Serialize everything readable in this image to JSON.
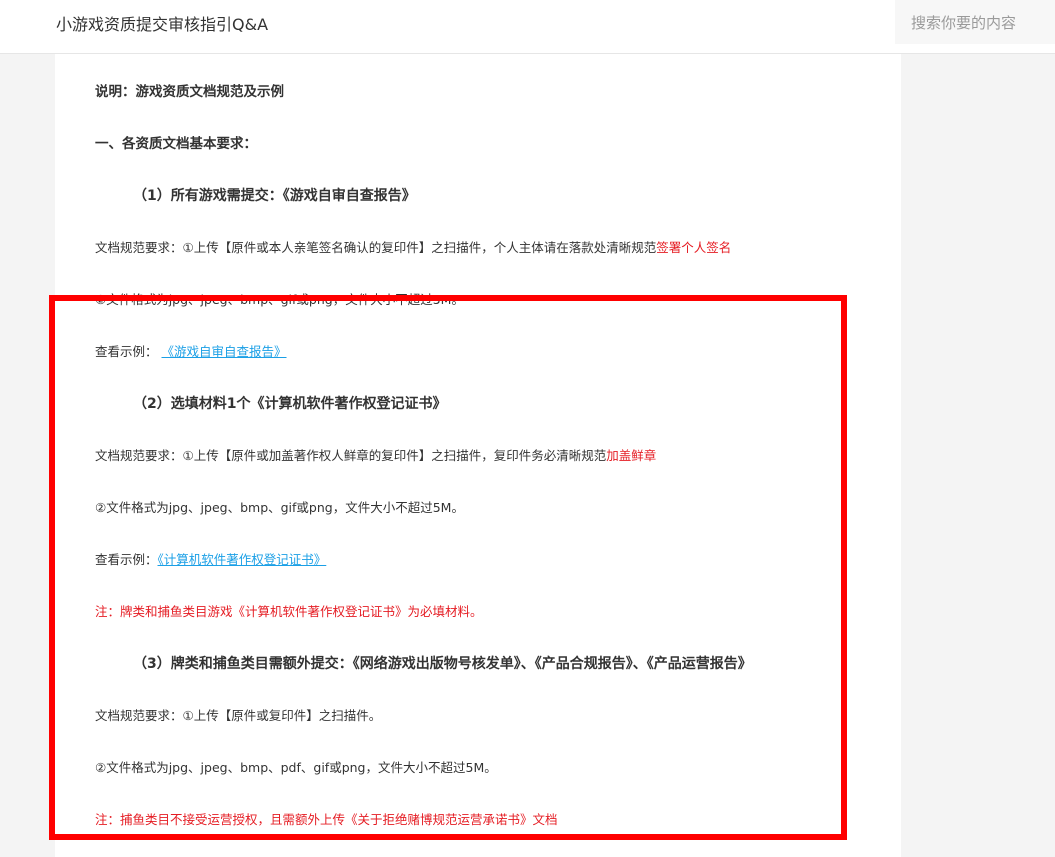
{
  "header": {
    "title": "小游戏资质提交审核指引Q&A",
    "search_placeholder": "搜索你要的内容"
  },
  "article": {
    "intro": "说明：游戏资质文档规范及示例",
    "section1_heading": "一、各资质文档基本要求：",
    "item1": {
      "heading": "（1）所有游戏需提交：《游戏自审自查报告》",
      "req_prefix": "文档规范要求：①上传【原件或本人亲笔签名确认的复印件】之扫描件，个人主体请在落款处清晰规范",
      "req_highlight": "签署个人签名",
      "format": "②文件格式为jpg、jpeg、bmp、gif或png，文件大小不超过5M。",
      "example_label": "查看示例：",
      "example_link": "《游戏自审自查报告》"
    },
    "item2": {
      "heading": "（2）选填材料1个《计算机软件著作权登记证书》",
      "req_prefix": "文档规范要求：①上传【原件或加盖著作权人鲜章的复印件】之扫描件，复印件务必清晰规范",
      "req_highlight": "加盖鲜章",
      "format": "②文件格式为jpg、jpeg、bmp、gif或png，文件大小不超过5M。",
      "example_label": "查看示例：",
      "example_link": "《计算机软件著作权登记证书》",
      "note": "注：牌类和捕鱼类目游戏《计算机软件著作权登记证书》为必填材料。"
    },
    "item3": {
      "heading": "（3）牌类和捕鱼类目需额外提交：《网络游戏出版物号核发单》、《产品合规报告》、《产品运营报告》",
      "req": "文档规范要求：①上传【原件或复印件】之扫描件。",
      "format": "②文件格式为jpg、jpeg、bmp、pdf、gif或png，文件大小不超过5M。",
      "note": "注：捕鱼类目不接受运营授权，且需额外上传《关于拒绝赌博规范运营承诺书》文档"
    }
  },
  "colors": {
    "highlight_red": "#e51c23",
    "link_blue": "#1a9fe6",
    "annotation_border": "#ff0000"
  }
}
